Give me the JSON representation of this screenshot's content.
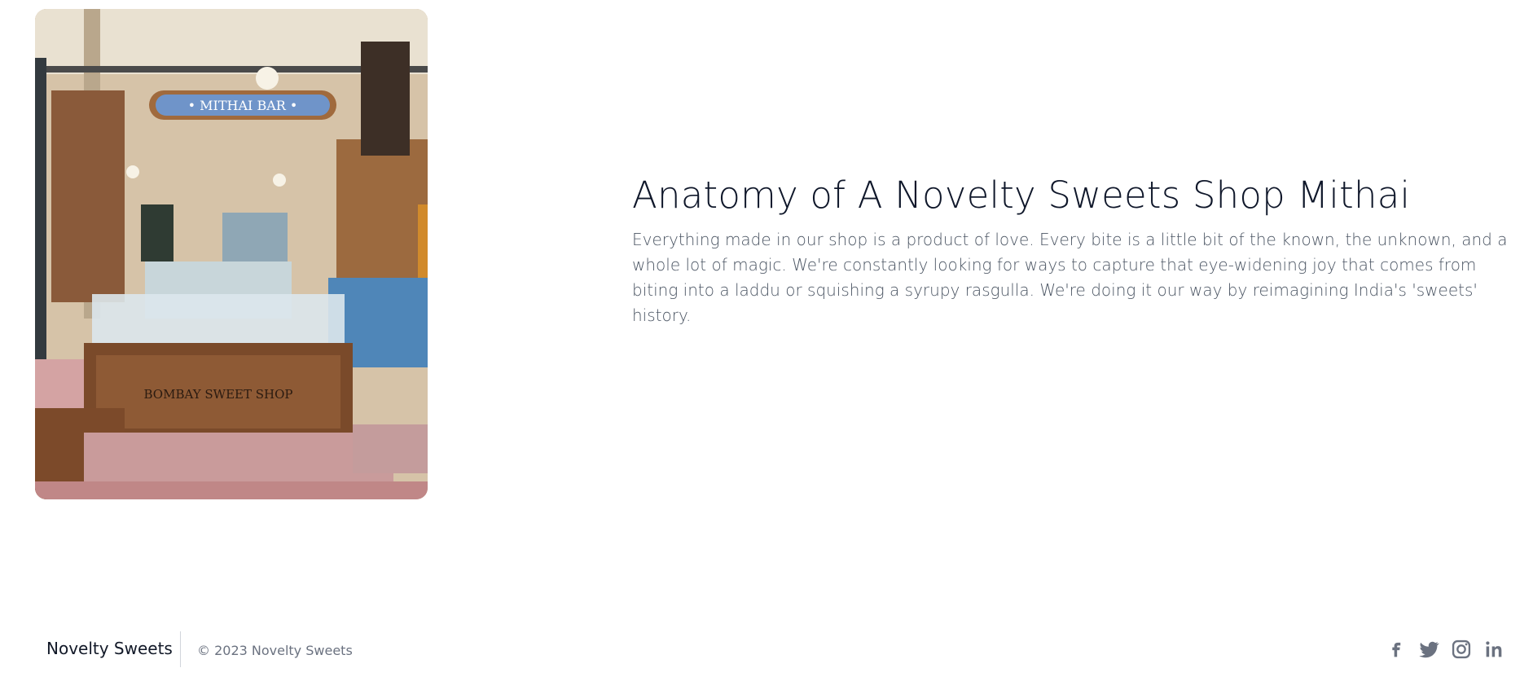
{
  "hero": {
    "image_alt": "Interior of a sweets shop with a Mithai Bar sign and glass display counter",
    "sign_text": "• MITHAI BAR •",
    "counter_sign_text": "BOMBAY SWEET SHOP"
  },
  "main": {
    "headline": "Anatomy of A Novelty Sweets Shop Mithai",
    "description": "Everything made in our shop is a product of love. Every bite is a little bit of the known, the unknown, and a whole lot of magic. We're constantly looking for ways to capture that eye-widening joy that comes from biting into a laddu or squishing a syrupy rasgulla. We're doing it our way by reimagining India's 'sweets' history."
  },
  "footer": {
    "brand": "Novelty Sweets",
    "copyright": "© 2023 Novelty Sweets",
    "social": [
      {
        "icon": "facebook-icon"
      },
      {
        "icon": "twitter-icon"
      },
      {
        "icon": "instagram-icon"
      },
      {
        "icon": "linkedin-icon"
      }
    ]
  },
  "colors": {
    "heading": "#0f172a",
    "body_text": "#4b5563",
    "muted": "#6b7280"
  }
}
